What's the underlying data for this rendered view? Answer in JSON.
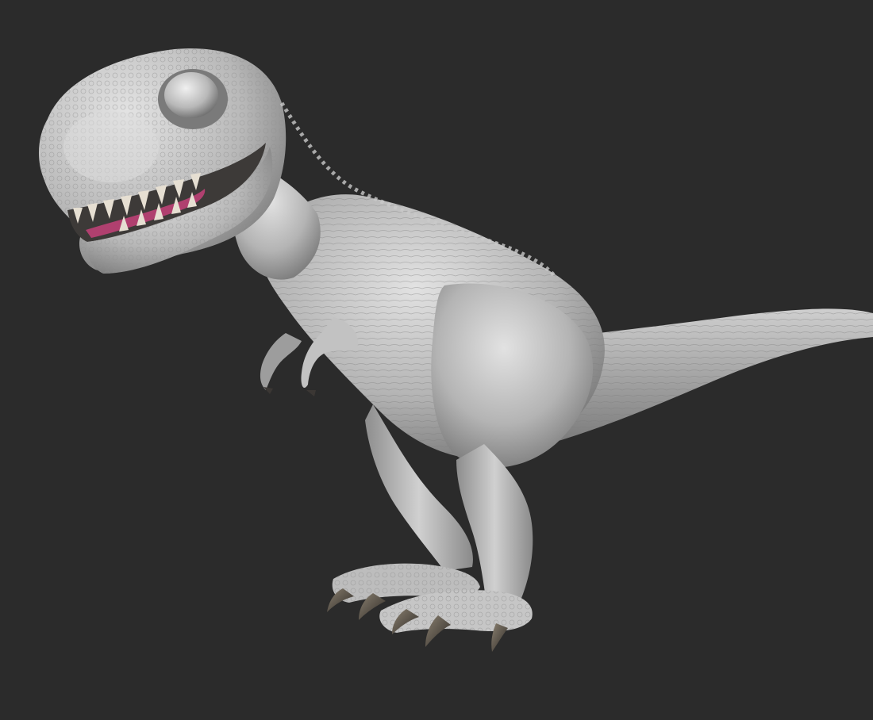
{
  "scene": {
    "subject": "t-rex-sculpt-render",
    "colors": {
      "background": "#2b2b2b",
      "skin_light": "#d6d6d6",
      "skin_mid": "#a9a9a9",
      "skin_dark": "#5a5a5a",
      "tongue": "#b0406f",
      "teeth": "#e6dfd2",
      "claws": "#4a4540"
    }
  }
}
